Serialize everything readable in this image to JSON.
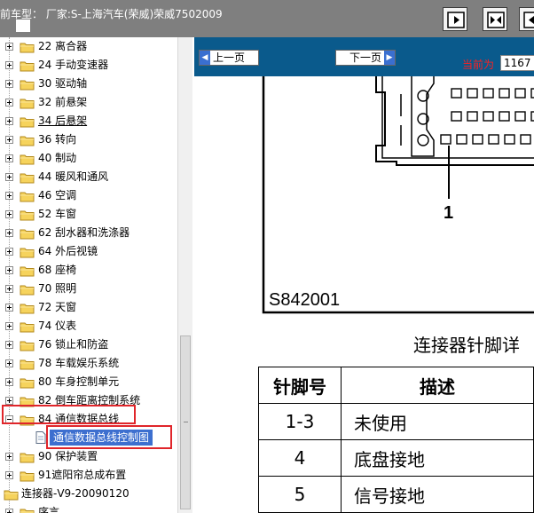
{
  "window": {
    "title": "前车型： 厂家:S-上海汽车(荣威)荣威7502009"
  },
  "toolbar": {
    "buttons": [
      {
        "name": "toolbar-button-next-icon"
      },
      {
        "name": "toolbar-button-fit-icon"
      },
      {
        "name": "toolbar-button-prev-icon"
      }
    ]
  },
  "tree": {
    "items": [
      {
        "label": "22 离合器",
        "type": "folder",
        "expanded": false,
        "underline": false
      },
      {
        "label": "24 手动变速器",
        "type": "folder",
        "expanded": false,
        "underline": false
      },
      {
        "label": "30 驱动轴",
        "type": "folder",
        "expanded": false,
        "underline": false
      },
      {
        "label": "32 前悬架",
        "type": "folder",
        "expanded": false,
        "underline": false
      },
      {
        "label": "34 后悬架",
        "type": "folder",
        "expanded": false,
        "underline": true
      },
      {
        "label": "36 转向",
        "type": "folder",
        "expanded": false,
        "underline": false
      },
      {
        "label": "40 制动",
        "type": "folder",
        "expanded": false,
        "underline": false
      },
      {
        "label": "44 暖风和通风",
        "type": "folder",
        "expanded": false,
        "underline": false
      },
      {
        "label": "46 空调",
        "type": "folder",
        "expanded": false,
        "underline": false
      },
      {
        "label": "52 车窗",
        "type": "folder",
        "expanded": false,
        "underline": false
      },
      {
        "label": "62 刮水器和洗涤器",
        "type": "folder",
        "expanded": false,
        "underline": false
      },
      {
        "label": "64 外后视镜",
        "type": "folder",
        "expanded": false,
        "underline": false
      },
      {
        "label": "68 座椅",
        "type": "folder",
        "expanded": false,
        "underline": false
      },
      {
        "label": "70 照明",
        "type": "folder",
        "expanded": false,
        "underline": false
      },
      {
        "label": "72 天窗",
        "type": "folder",
        "expanded": false,
        "underline": false
      },
      {
        "label": "74 仪表",
        "type": "folder",
        "expanded": false,
        "underline": false
      },
      {
        "label": "76 锁止和防盗",
        "type": "folder",
        "expanded": false,
        "underline": false
      },
      {
        "label": "78 车载娱乐系统",
        "type": "folder",
        "expanded": false,
        "underline": false
      },
      {
        "label": "80 车身控制单元",
        "type": "folder",
        "expanded": false,
        "underline": false
      },
      {
        "label": "82 倒车距离控制系统",
        "type": "folder",
        "expanded": false,
        "underline": false
      },
      {
        "label": "84 通信数据总线",
        "type": "folder",
        "expanded": true,
        "underline": false
      },
      {
        "label": "通信数据总线控制图",
        "type": "document",
        "selected": true
      },
      {
        "label": "90 保护装置",
        "type": "folder",
        "expanded": false,
        "underline": false
      },
      {
        "label": "91遮阳帘总成布置",
        "type": "folder",
        "expanded": false,
        "underline": false
      },
      {
        "label": "连接器-V9-20090120",
        "type": "root",
        "expanded": true
      },
      {
        "label": "序言",
        "type": "folder",
        "expanded": false,
        "underline": false
      }
    ]
  },
  "viewer": {
    "prev_label": "上一页",
    "next_label": "下一页",
    "current_label": "当前为",
    "current_value": "1167",
    "figure_code": "S842001",
    "callout": "1",
    "doc_title": "连接器针脚详",
    "table": {
      "headers": [
        "针脚号",
        "描述"
      ],
      "rows": [
        [
          "1-3",
          "未使用"
        ],
        [
          "4",
          "底盘接地"
        ],
        [
          "5",
          "信号接地"
        ]
      ]
    }
  },
  "colors": {
    "titlebar": "#7f7f7f",
    "docbar": "#0a5a8c",
    "selection": "#3d6fcf",
    "highlight": "#e0252a",
    "current_label": "#ff2020"
  }
}
